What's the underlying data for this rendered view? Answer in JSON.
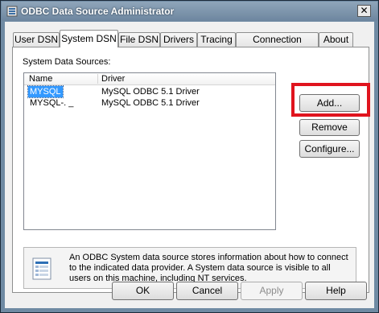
{
  "window": {
    "title": "ODBC Data Source Administrator",
    "close_symbol": "✕"
  },
  "tabs": [
    {
      "label": "User DSN"
    },
    {
      "label": "System DSN"
    },
    {
      "label": "File DSN"
    },
    {
      "label": "Drivers"
    },
    {
      "label": "Tracing"
    },
    {
      "label": "Connection Pooling"
    },
    {
      "label": "About"
    }
  ],
  "active_tab": "System DSN",
  "system_dsn": {
    "section_label": "System Data Sources:",
    "columns": [
      "Name",
      "Driver"
    ],
    "rows": [
      {
        "name": "MYSQL",
        "driver": "MySQL ODBC 5.1 Driver",
        "selected": true
      },
      {
        "name": "MYSQL-. _",
        "driver": "MySQL ODBC 5.1 Driver",
        "selected": false
      }
    ],
    "buttons": {
      "add": "Add...",
      "remove": "Remove",
      "configure": "Configure..."
    },
    "info_text": "An ODBC System data source stores information about how to connect to the indicated data provider.   A System data source is visible to all users on this machine, including NT services."
  },
  "footer": {
    "ok": "OK",
    "cancel": "Cancel",
    "apply": "Apply",
    "help": "Help"
  },
  "colors": {
    "highlight_box": "#e0141e",
    "selection": "#3399ff"
  },
  "icons": {
    "app": "odbc-app-icon",
    "info": "data-source-document-icon"
  }
}
